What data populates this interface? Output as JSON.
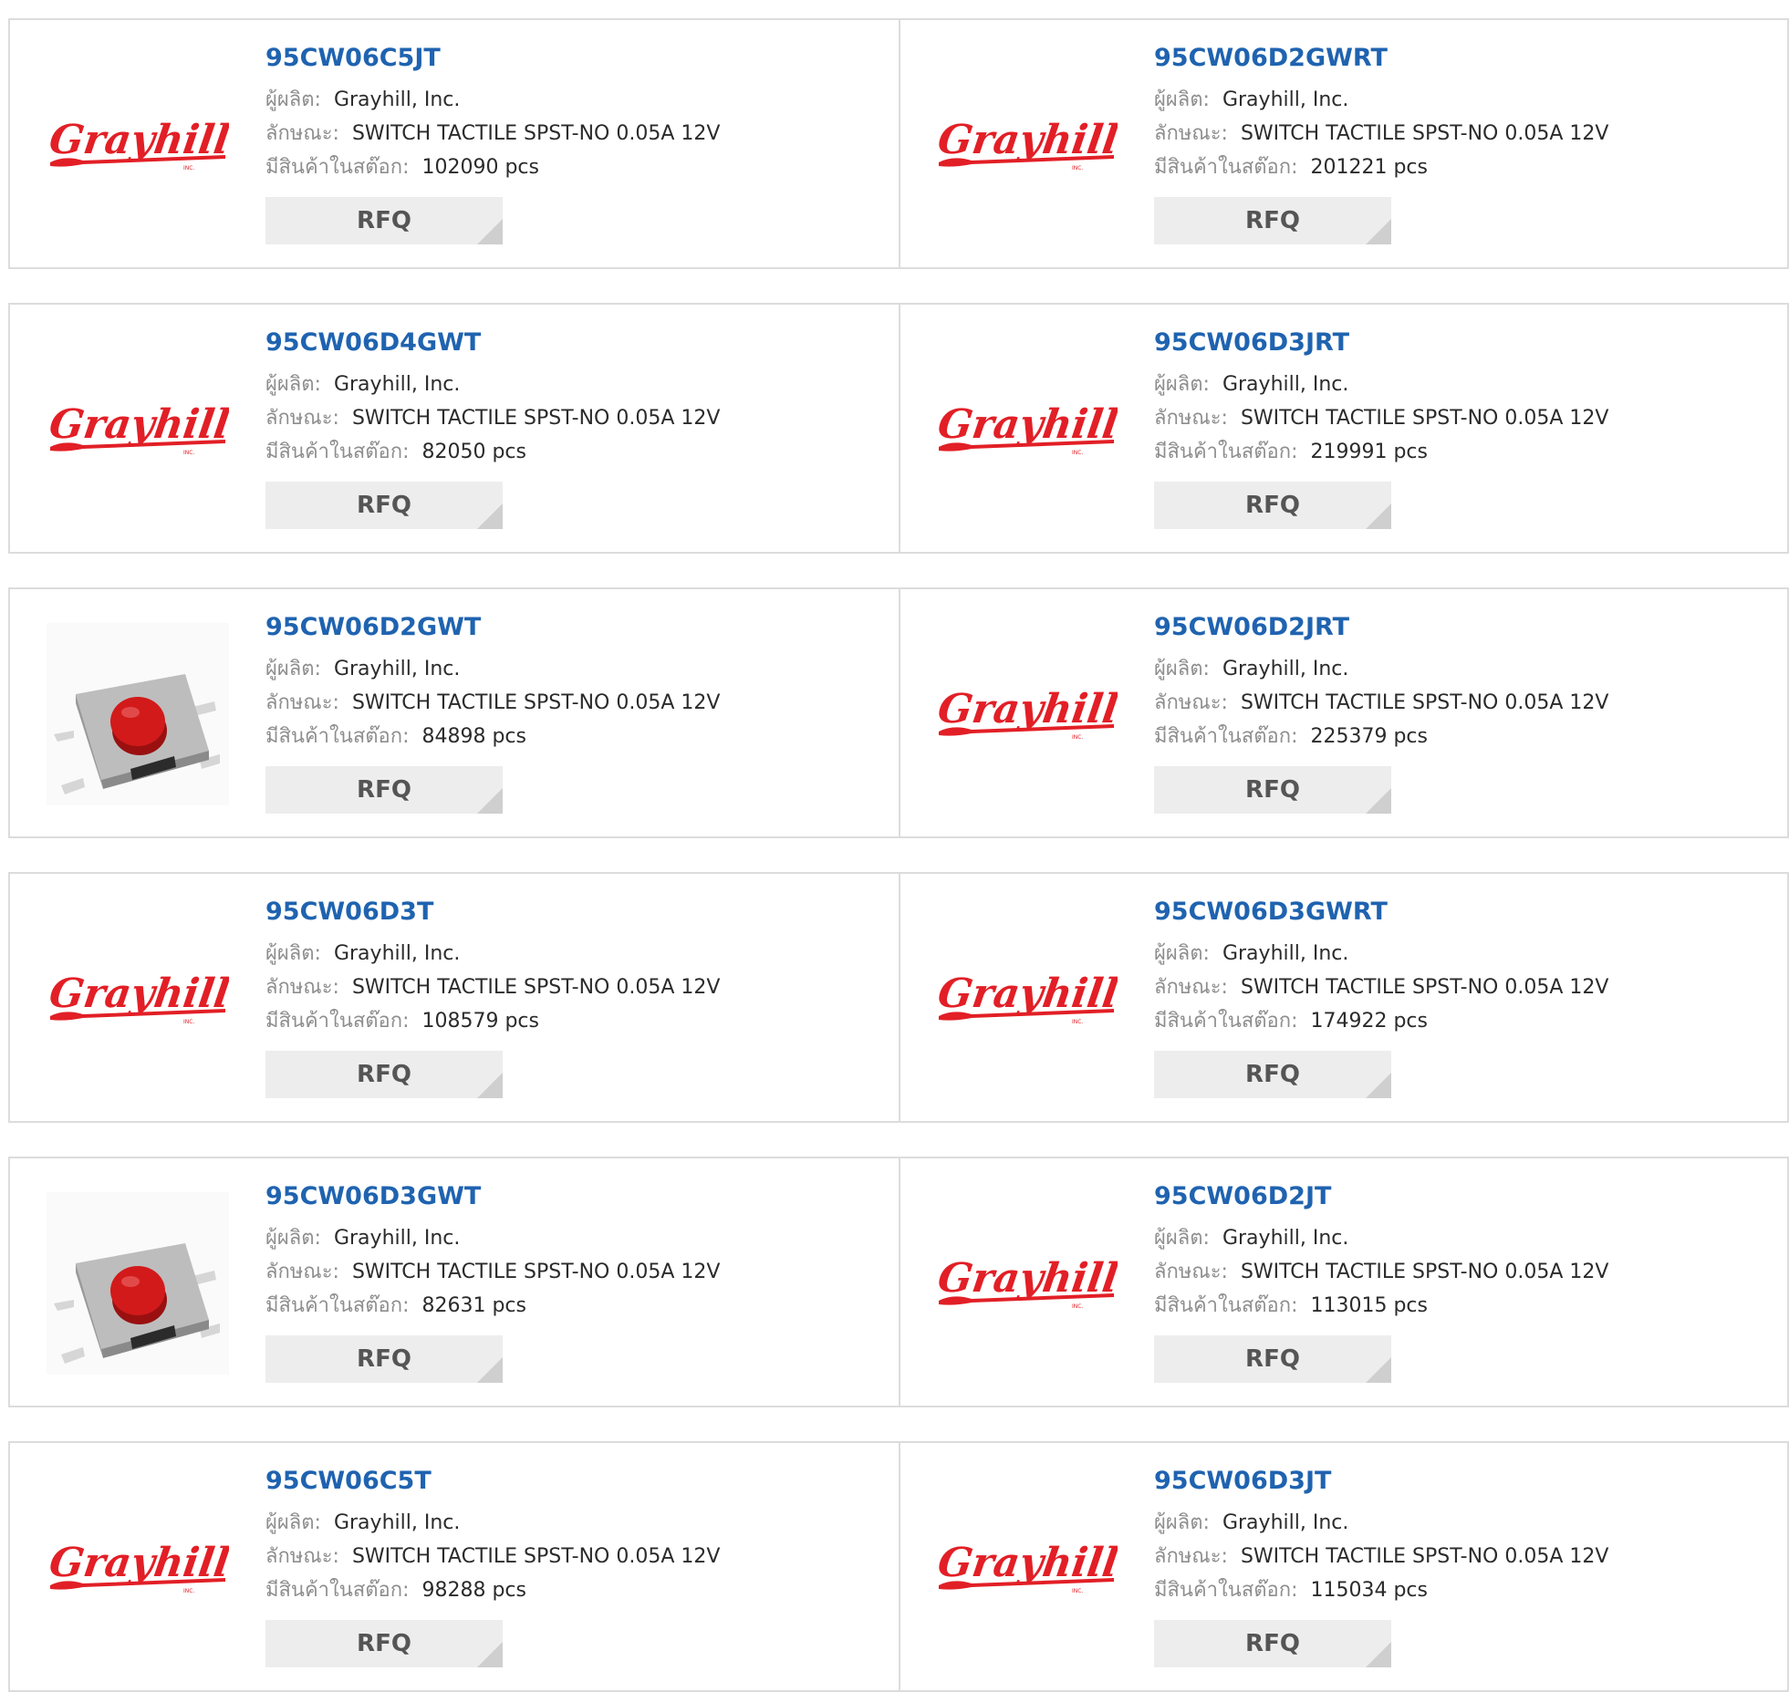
{
  "labels": {
    "manufacturer": "ผู้ผลิต:",
    "description": "ลักษณะ:",
    "stock": "มีสินค้าในสต๊อก:",
    "rfq": "RFQ"
  },
  "colors": {
    "part_link": "#1f63b0",
    "grayhill_red": "#e21f26",
    "button_bg": "#ededed"
  },
  "products": [
    {
      "part": "95CW06C5JT",
      "manufacturer": "Grayhill, Inc.",
      "description": "SWITCH TACTILE SPST-NO 0.05A 12V",
      "stock": "102090 pcs",
      "image": "grayhill-logo"
    },
    {
      "part": "95CW06D2GWRT",
      "manufacturer": "Grayhill, Inc.",
      "description": "SWITCH TACTILE SPST-NO 0.05A 12V",
      "stock": "201221 pcs",
      "image": "grayhill-logo"
    },
    {
      "part": "95CW06D4GWT",
      "manufacturer": "Grayhill, Inc.",
      "description": "SWITCH TACTILE SPST-NO 0.05A 12V",
      "stock": "82050 pcs",
      "image": "grayhill-logo"
    },
    {
      "part": "95CW06D3JRT",
      "manufacturer": "Grayhill, Inc.",
      "description": "SWITCH TACTILE SPST-NO 0.05A 12V",
      "stock": "219991 pcs",
      "image": "grayhill-logo"
    },
    {
      "part": "95CW06D2GWT",
      "manufacturer": "Grayhill, Inc.",
      "description": "SWITCH TACTILE SPST-NO 0.05A 12V",
      "stock": "84898 pcs",
      "image": "tactile-switch-photo"
    },
    {
      "part": "95CW06D2JRT",
      "manufacturer": "Grayhill, Inc.",
      "description": "SWITCH TACTILE SPST-NO 0.05A 12V",
      "stock": "225379 pcs",
      "image": "grayhill-logo"
    },
    {
      "part": "95CW06D3T",
      "manufacturer": "Grayhill, Inc.",
      "description": "SWITCH TACTILE SPST-NO 0.05A 12V",
      "stock": "108579 pcs",
      "image": "grayhill-logo"
    },
    {
      "part": "95CW06D3GWRT",
      "manufacturer": "Grayhill, Inc.",
      "description": "SWITCH TACTILE SPST-NO 0.05A 12V",
      "stock": "174922 pcs",
      "image": "grayhill-logo"
    },
    {
      "part": "95CW06D3GWT",
      "manufacturer": "Grayhill, Inc.",
      "description": "SWITCH TACTILE SPST-NO 0.05A 12V",
      "stock": "82631 pcs",
      "image": "tactile-switch-photo"
    },
    {
      "part": "95CW06D2JT",
      "manufacturer": "Grayhill, Inc.",
      "description": "SWITCH TACTILE SPST-NO 0.05A 12V",
      "stock": "113015 pcs",
      "image": "grayhill-logo"
    },
    {
      "part": "95CW06C5T",
      "manufacturer": "Grayhill, Inc.",
      "description": "SWITCH TACTILE SPST-NO 0.05A 12V",
      "stock": "98288 pcs",
      "image": "grayhill-logo"
    },
    {
      "part": "95CW06D3JT",
      "manufacturer": "Grayhill, Inc.",
      "description": "SWITCH TACTILE SPST-NO 0.05A 12V",
      "stock": "115034 pcs",
      "image": "grayhill-logo"
    }
  ]
}
